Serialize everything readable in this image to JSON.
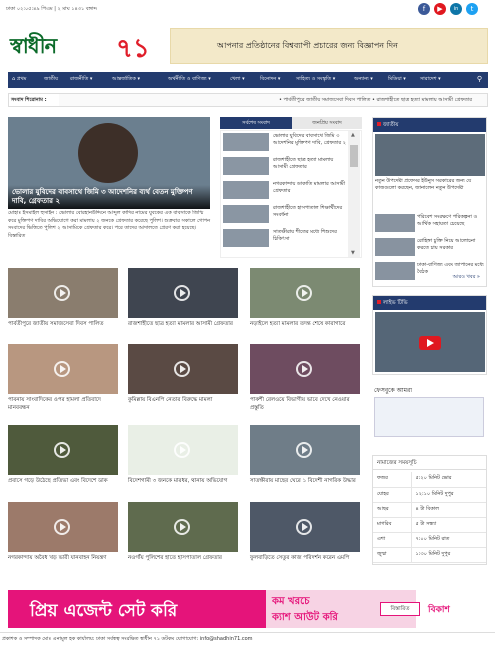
{
  "topbar": {
    "date": "ঢাকা  ০২:০৫:৪৯ পিএম | ২ মাঘ ১৪৩১ বঙ্গাব্দ",
    "social": [
      {
        "icon": "facebook-icon",
        "glyph": "f",
        "color": "#3b5998"
      },
      {
        "icon": "youtube-icon",
        "glyph": "▶",
        "color": "#e0181f"
      },
      {
        "icon": "linkedin-icon",
        "glyph": "in",
        "color": "#0e76a8"
      },
      {
        "icon": "twitter-icon",
        "glyph": "t",
        "color": "#1da1f2"
      }
    ]
  },
  "logo": {
    "text": "স্বাধীন",
    "num": "৭১"
  },
  "ad": {
    "text": "আপনার প্রতিষ্ঠানের বিশ্বব্যাপী প্রচারের জন্য বিজ্ঞাপন দিন"
  },
  "nav": {
    "items": [
      "⌂ প্রথম",
      "জাতীয়",
      "রাজনীতি ▾",
      "আন্তর্জাতিক ▾",
      "অর্থনীতি ও বাণিজ্য ▾",
      "খেলা ▾",
      "বিনোদন ▾",
      "সাহিত্য ও সংস্কৃতি ▾",
      "অন্যান্য ▾",
      "মিডিয়া ▾",
      "সারাদেশ ▾"
    ],
    "search_icon": "⚲"
  },
  "ticker": {
    "label": "সংবাদ শিরোনাম :",
    "text": "• পার্বতীপুরে জাতীয় সমাজসেবা দিবস পালিত  • রাজশাহীতে ছাত্র হত্যা মামলায় আসামী গ্রেফতার"
  },
  "lead": {
    "caption": "ভোলার যুবিদের বাবসাথে জিমি ৩ আদেশনির ব্যর্থ বেতন মুক্তিপণ দাবি, গ্রেফতার ২",
    "summary": "মোহাঃ ইসমাইল হুসাইন : ভোলার বোরহানউদ্দিনে আব্দুল কাদির নামের যুবকের এক বাবসাকে জিম্মি করে মুক্তিপণ দাবির অভিযোগে করা মামলায় ২ জনকে গ্রেফতার করেছে পুলিশ। শুক্রবার সকালে গোপন সংবাদের ভিত্তিতে পুলিশ ২ আসামিকে গ্রেফতার করে। পরে তাদের আদালতে প্রেরণ করা হয়েছে। বিস্তারিত"
  },
  "tabs": {
    "latest": "সর্বশেষ সংবাদ",
    "popular": "জনপ্রিয় সংবাদ"
  },
  "latest": [
    "ভোলার যুবিদের বাবসাথে জিমি ৩ আদেশনির মুক্তিপণ দাবি, গ্রেফতার ২",
    "রাজশাহীতে ছাত্র হত্যা মামলায় আসামী গ্রেফতার",
    "নগরকান্দায় ডাকাতি মামলার আসামী গ্রেফতার",
    "রাজশাহীতে হাসপাতাল শিক্ষার্থীদের সংবর্ধনা",
    "সাতক্ষীরায় শীতের মধ্যে শিশুদের চিকিৎসা",
    "রাজশাহীতে আন্দোলন কারিদের নিয়ে সভা"
  ],
  "grid": [
    "পার্বতীপুরে জাতীয় সমাজসেবা দিবস পালিত",
    "রাজশাহীতে ছাত্র হত্যা মামলার আসামী গ্রেফতার",
    "নড়াইলে হত্যা মামলার তদন্ত শেষে কারাগারে",
    "পাবনায় সাংবাদিকের ওপর হামলা প্রতিবাদে মানববন্ধন",
    "কুমিল্লায় বিএনপি নেতার বিরুদ্ধে মামলা",
    "পাকশী রেলওয়ে বিভাগীয় ভাবে দেখে নেওয়ার প্রস্তুতি",
    "প্রবাসে গড়ে উঠেছে প্রতিভা এবং বিদেশে ডাক",
    "বিদেশগামী ৩ জনকে মারধর, থানায় অভিযোগ",
    "সাতক্ষীরায় মাছের ঘেরে ১ বিদেশী নাগরিক উদ্ধার",
    "নগরকান্দায় অবৈধ খড় ভারী যানবাহন নিয়ন্ত্রণ",
    "নওগাঁয় পুলিশের হাতে হাসপাতাল গ্রেফতার",
    "ফুলবাড়িতে সেতুর কাজ পরিদর্শন করেন এমপি"
  ],
  "national": {
    "header": "জাতীয়",
    "lead": "নতুন উপদেষ্টা প্রফেসর ইউনুস সরকারের জন্য যে কাজগুলো করছেন, জানালেন নতুন উপদেষ্টা",
    "rows": [
      "পরিবেশ সংরক্ষণে পরিকল্পনা ও আর্থিক সহায়তা চেয়েছে",
      "রোহিঙ্গা চুক্তি নিয়ে আলোচনা করতে চায় সরকার",
      "ঢাকা-বাণিজ্য এবং জাপানের মধ্যে বৈঠক"
    ],
    "more": "আরও খবর »"
  },
  "live": {
    "header": "লাইভ টিভি"
  },
  "follow": {
    "label": "ফেসবুকে আমরা"
  },
  "prayer": {
    "header": "নামাজের সময়সূচি",
    "rows": [
      [
        "ফজর",
        "৫:২০ মিনিট ভোর"
      ],
      [
        "যোহর",
        "১২:১০ মিনিট দুপুর"
      ],
      [
        "আছর",
        "৪ টা বিকাল"
      ],
      [
        "মাগরিব",
        "৫ টা সন্ধ্যা"
      ],
      [
        "এশা",
        "৭:০০ মিনিট রাত"
      ],
      [
        "জুম্মা",
        "১:৩০ মিনিট দুপুর"
      ]
    ]
  },
  "banner": {
    "left": "প্রিয় এজেন্ট সেট করি",
    "line1": "কম খরচে",
    "line2": "ক্যাশ আউট করি",
    "btn": "বিস্তারিত",
    "brand": "বিকাশ"
  },
  "footer": {
    "text": "প্রকাশক ও সম্পাদক মোঃ এনামুল হক  কার্যালয়: ঢাকা  সর্বস্বত্ব সংরক্ষিত  স্বাধীন ৭১ ডটকম  যোগাযোগ: info@shadhin71.com"
  }
}
